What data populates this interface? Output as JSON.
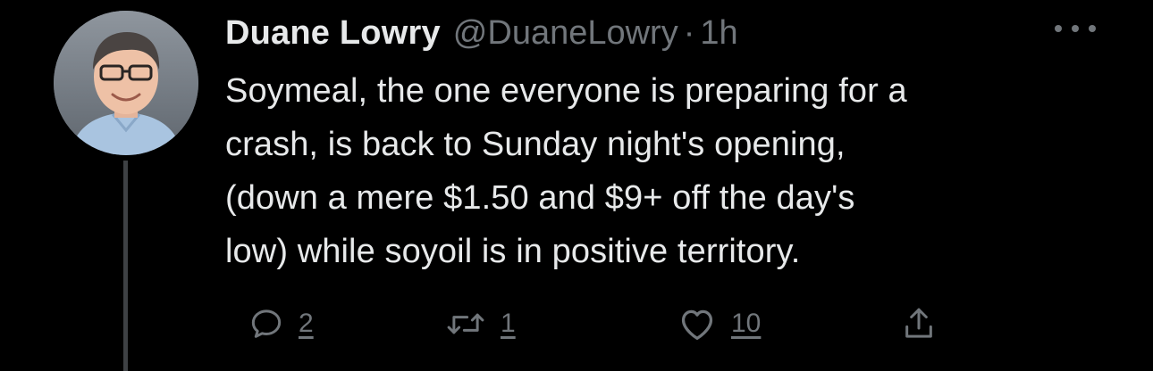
{
  "tweet": {
    "author": {
      "display_name": "Duane Lowry",
      "handle": "@DuaneLowry",
      "avatar_icon": "profile-photo"
    },
    "separator": "·",
    "time": "1h",
    "more_icon": "ellipsis-icon",
    "text_lines": [
      "Soymeal, the one everyone is preparing for a",
      "crash, is back to Sunday night's opening,",
      "(down a mere $1.50 and $9+ off the day's",
      "low) while soyoil is in positive territory."
    ],
    "actions": {
      "reply": {
        "icon": "reply-icon",
        "count": "2"
      },
      "retweet": {
        "icon": "retweet-icon",
        "count": "1"
      },
      "like": {
        "icon": "heart-icon",
        "count": "10"
      },
      "share": {
        "icon": "share-icon"
      }
    }
  },
  "colors": {
    "background": "#000000",
    "primary_text": "#e7e9ea",
    "secondary_text": "#71767b",
    "thread_line": "#3e4144"
  }
}
